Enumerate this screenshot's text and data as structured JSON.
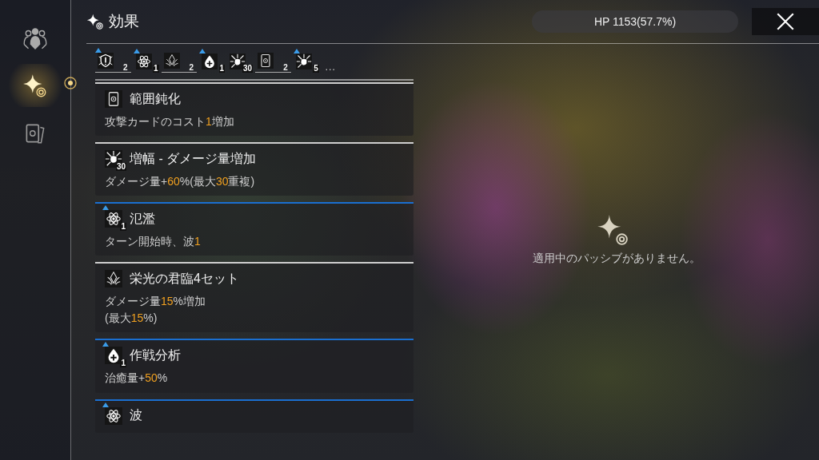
{
  "sidebar": {
    "tabs": [
      {
        "kind": "people",
        "selected": false
      },
      {
        "kind": "sparkle",
        "selected": true
      },
      {
        "kind": "cards",
        "selected": false
      }
    ]
  },
  "header": {
    "title": "効果",
    "hp": "HP 1153(57.7%)"
  },
  "effect_strip": {
    "items": [
      {
        "kind": "shield",
        "buff": true,
        "count": "2",
        "bracketed": true
      },
      {
        "kind": "atom",
        "buff": true,
        "count": "1",
        "bracketed": false
      },
      {
        "kind": "crystal",
        "buff": false,
        "count": "2",
        "bracketed": true
      },
      {
        "kind": "drop",
        "buff": true,
        "count": "1",
        "bracketed": false
      },
      {
        "kind": "burst",
        "buff": false,
        "count": "30",
        "bracketed": false
      },
      {
        "kind": "card",
        "buff": false,
        "count": "2",
        "bracketed": true
      },
      {
        "kind": "burst",
        "buff": true,
        "count": "5",
        "bracketed": false
      }
    ],
    "more": "…"
  },
  "effects": [
    {
      "kind": "card",
      "buff": false,
      "title": "範囲鈍化",
      "lines": [
        "攻撃カードのコスト**1**増加"
      ]
    },
    {
      "kind": "burst",
      "buff": false,
      "count": "30",
      "title": "増幅 - ダメージ量増加",
      "lines": [
        "ダメージ量+**60**%(最大**30**重複)"
      ]
    },
    {
      "kind": "atom",
      "buff": true,
      "count": "1",
      "title": "氾濫",
      "lines": [
        "ターン開始時、波**1**"
      ]
    },
    {
      "kind": "crystal",
      "buff": false,
      "title": "栄光の君臨4セット",
      "lines": [
        "ダメージ量**15**%増加",
        "(最大**15**%)"
      ]
    },
    {
      "kind": "drop",
      "buff": true,
      "count": "1",
      "title": "作戦分析",
      "lines": [
        "治癒量+**50**%"
      ]
    },
    {
      "kind": "atom",
      "buff": true,
      "title": "波"
    }
  ],
  "passive": {
    "empty_message": "適用中のパッシブがありません。"
  }
}
